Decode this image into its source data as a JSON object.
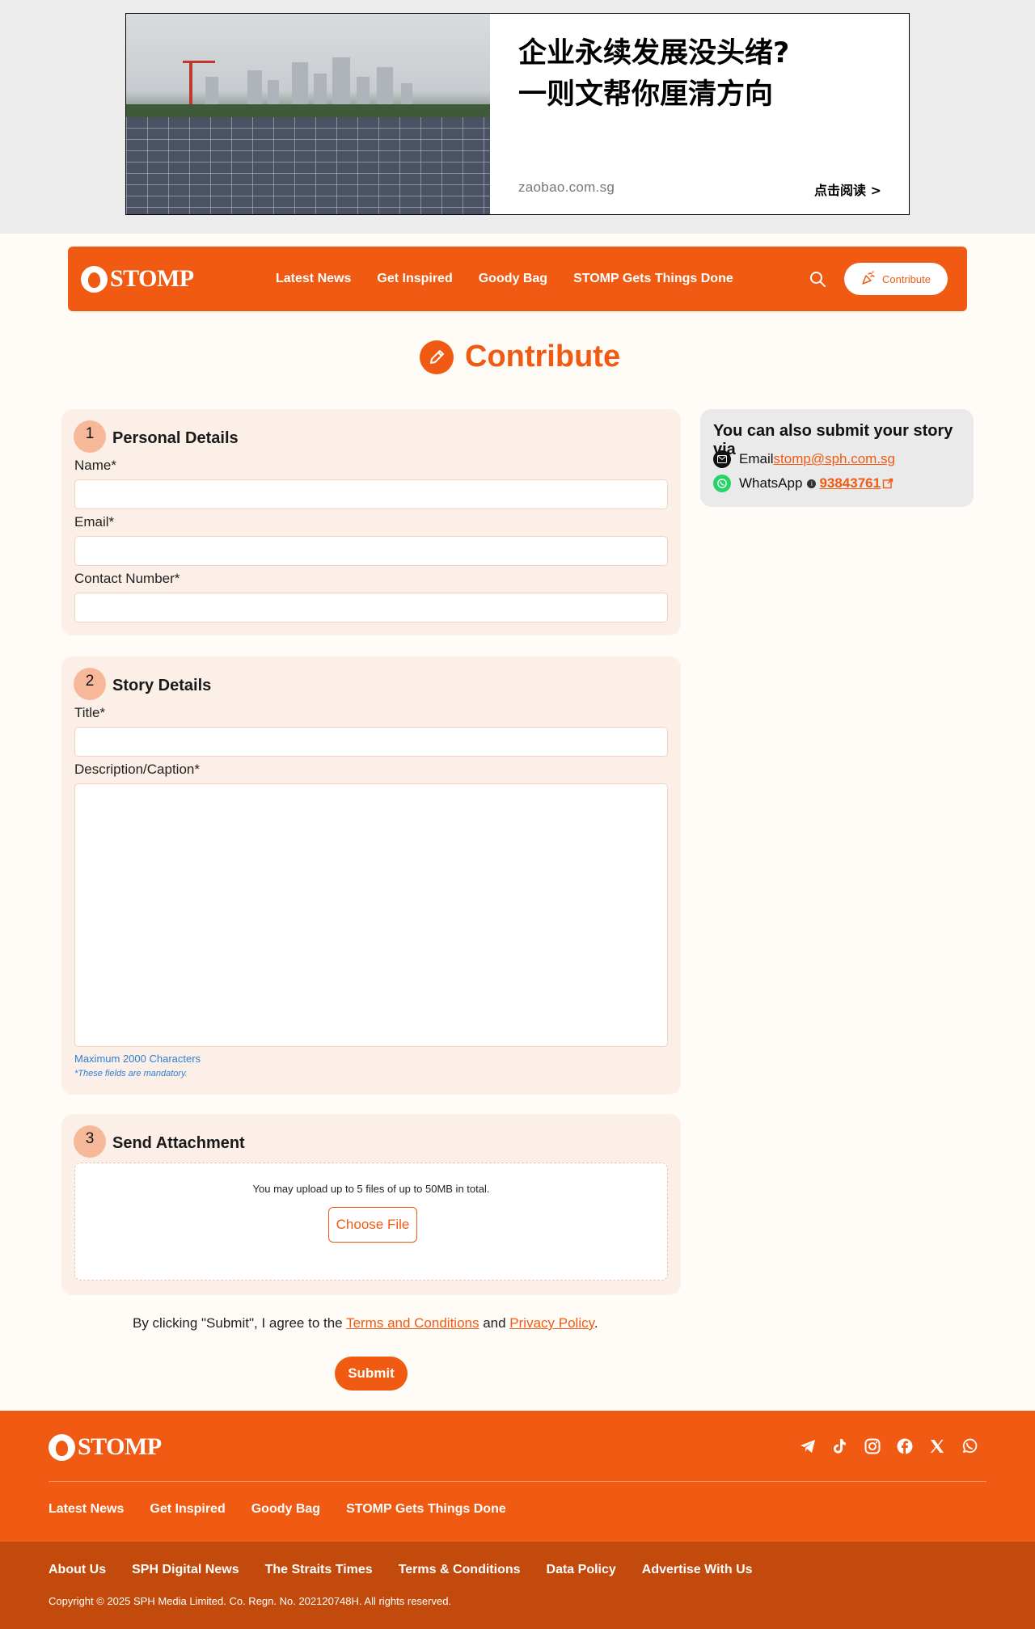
{
  "ad": {
    "headline": "企业永续发展没头绪?\n一则文帮你厘清方向",
    "domain": "zaobao.com.sg",
    "cta": "点击阅读 >"
  },
  "header": {
    "logo_text": "STOMP",
    "nav": [
      "Latest News",
      "Get Inspired",
      "Goody Bag",
      "STOMP Gets Things Done"
    ],
    "contribute_label": "Contribute",
    "brand_color": "#f05a12"
  },
  "page": {
    "title": "Contribute"
  },
  "personal": {
    "number": "1",
    "title": "Personal Details",
    "name_label": "Name*",
    "email_label": "Email*",
    "contact_label": "Contact Number*"
  },
  "story": {
    "number": "2",
    "title": "Story Details",
    "title_label": "Title*",
    "desc_label": "Description/Caption*",
    "max_chars": "Maximum 2000 Characters",
    "mandatory": "*These fields are mandatory."
  },
  "attach": {
    "number": "3",
    "title": "Send Attachment",
    "note": "You may upload up to 5 files of up to 50MB in total.",
    "choose_label": "Choose File"
  },
  "side": {
    "title": "You can also submit your story via",
    "email_label": "Email",
    "email": "stomp@sph.com.sg",
    "whatsapp_label": "WhatsApp",
    "whatsapp_number": "93843761"
  },
  "agree": {
    "prefix": "By clicking \"Submit\", I agree to the ",
    "terms": "Terms and Conditions",
    "and": " and ",
    "privacy": "Privacy Policy",
    "suffix": "."
  },
  "submit_label": "Submit",
  "footer": {
    "logo_text": "STOMP",
    "nav": [
      "Latest News",
      "Get Inspired",
      "Goody Bag",
      "STOMP Gets Things Done"
    ],
    "legal": [
      "About Us",
      "SPH Digital News",
      "The Straits Times",
      "Terms & Conditions",
      "Data Policy",
      "Advertise With Us"
    ],
    "copyright": "Copyright © 2025 SPH Media Limited. Co. Regn. No. 202120748H. All rights reserved.",
    "socials": [
      "telegram-icon",
      "tiktok-icon",
      "instagram-icon",
      "facebook-icon",
      "x-icon",
      "whatsapp-icon"
    ]
  }
}
